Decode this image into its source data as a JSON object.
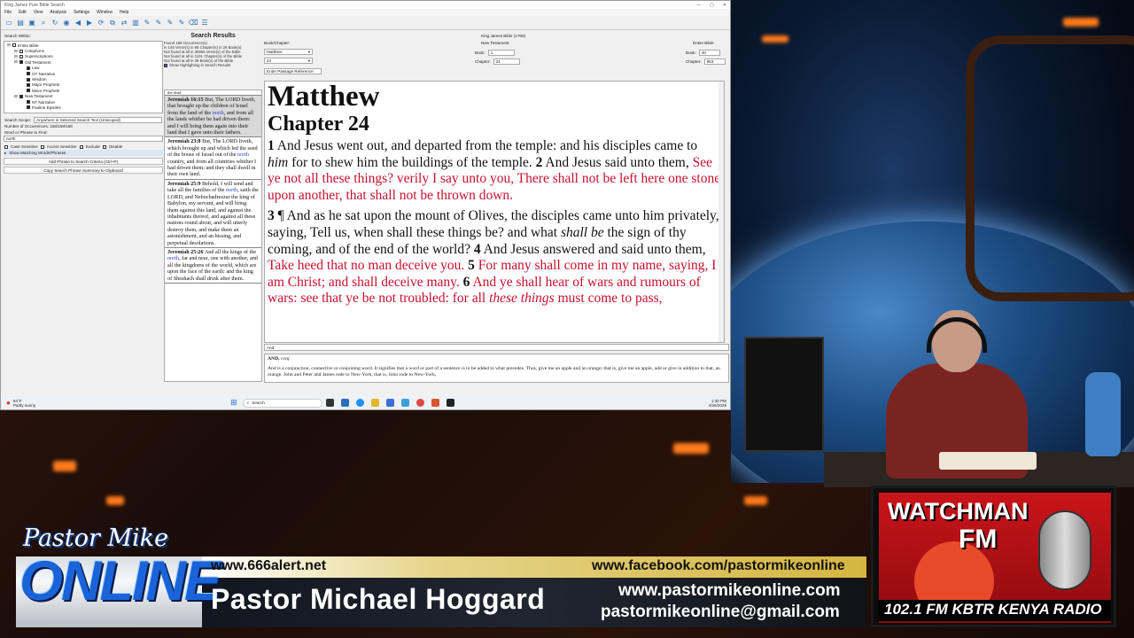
{
  "app": {
    "title": "King James Pure Bible Search",
    "menu": [
      "File",
      "Edit",
      "View",
      "Analysis",
      "Settings",
      "Window",
      "Help"
    ],
    "search_within_label": "Search Within:",
    "tree": [
      {
        "label": "Entire Bible",
        "checked": false,
        "indent": 0
      },
      {
        "label": "Colophons",
        "checked": false,
        "indent": 1
      },
      {
        "label": "Superscriptions",
        "checked": false,
        "indent": 1
      },
      {
        "label": "Old Testament",
        "checked": true,
        "indent": 1
      },
      {
        "label": "Law",
        "checked": true,
        "indent": 2
      },
      {
        "label": "OT Narrative",
        "checked": true,
        "indent": 2
      },
      {
        "label": "Wisdom",
        "checked": true,
        "indent": 2
      },
      {
        "label": "Major Prophets",
        "checked": true,
        "indent": 2
      },
      {
        "label": "Minor Prophets",
        "checked": true,
        "indent": 2
      },
      {
        "label": "New Testament",
        "checked": true,
        "indent": 1
      },
      {
        "label": "NT Narrative",
        "checked": true,
        "indent": 2
      },
      {
        "label": "Pauline Epistles",
        "checked": true,
        "indent": 2
      }
    ],
    "search_scope_label": "Search Scope:",
    "search_scope_value": "Anywhere in Selected Search Text (Unscoped)",
    "occurrences_label": "Number of Occurrences: 158/158/158",
    "word_phrase_label": "Word or Phrase to Find:",
    "search_value": "north",
    "options": [
      "Case Sensitive",
      "Accent Sensitive",
      "Exclude",
      "Disable"
    ],
    "show_matching": "Show Matching Words/Phrases",
    "add_phrase_btn": "Add Phrase to Search Criteria (Ctrl+P)",
    "copy_summary_btn": "Copy Search Phrase Summary to Clipboard",
    "results_header": "Search Results",
    "results_stats": [
      "Found 158 Occurrence(s)",
      "in 146 Verse(s) in 88 Chapter(s) in 28 Book(s)",
      "Not found at all in 30956 Verse(s) of the Bible",
      "Not found at all in 1101 Chapter(s) of the Bible",
      "Not found at all in 38 Book(s) of the Bible",
      "Show Highlighting in Search Results"
    ],
    "results_cut": "the dead.",
    "results": [
      {
        "ref": "Jeremiah 16:15",
        "pre": "But, The LORD liveth, that brought up the children of Israel from the land of the ",
        "hl": "north",
        "post": ", and from all the lands whither he had driven them: and I will bring them again into their land that I gave unto their fathers.",
        "selected": true
      },
      {
        "ref": "Jeremiah 23:8",
        "pre": "But, The LORD liveth, which brought up and which led the seed of the house of Israel out of the ",
        "hl": "north",
        "post": " country, and from all countries whither I had driven them; and they shall dwell in their own land.",
        "selected": false
      },
      {
        "ref": "Jeremiah 25:9",
        "pre": "Behold, I will send and take all the families of the ",
        "hl": "north",
        "post": ", saith the LORD, and Nebuchadrezzar the king of Babylon, my servant, and will bring them against this land, and against the inhabitants thereof, and against all these nations round about, and will utterly destroy them, and make them an astonishment, and an hissing, and perpetual desolations.",
        "selected": false
      },
      {
        "ref": "Jeremiah 25:26",
        "pre": "And all the kings of the ",
        "hl": "north",
        "post": ", far and near, one with another, and all the kingdoms of the world, which are upon the face of the earth: and the king of Sheshach shall drink after them.",
        "selected": false
      }
    ],
    "nav": {
      "book_chapter_label": "Book/Chapter:",
      "book_value": "Matthew",
      "chapter_value": "24",
      "version": "King James Bible (1769)",
      "nt_label": "New Testament",
      "book_label": "Book:",
      "book_num": "1",
      "chapter_label": "Chapter:",
      "chapter_num": "24",
      "entire_label": "Entire Bible:",
      "entire_book": "40",
      "entire_chapter": "953",
      "passage_ref_label": "Enter Passage Reference:"
    },
    "passage": {
      "book": "Matthew",
      "chapter": "Chapter 24",
      "v1_num": "1",
      "v1_a": " And Jesus went out, and departed from the temple: and his disciples came to ",
      "v1_i": "him",
      "v1_b": " for to shew him the buildings of the temple. ",
      "v2_num": "2",
      "v2_a": " And Jesus said unto them, ",
      "v2_red": "See ye not all these things? verily I say unto you, There shall not be left here one stone upon another, that shall not be thrown down.",
      "v3_num": "3",
      "v3_a": " ¶ And as he sat upon the mount of Olives, the disciples came unto him privately, saying, Tell us, when shall these things be? and what ",
      "v3_i": "shall be",
      "v3_b": " the sign of thy coming, and of the end of the world? ",
      "v4_num": "4",
      "v4_a": " And Jesus answered and said unto them, ",
      "v4_red": "Take heed that no man deceive you. ",
      "v5_num": "5",
      "v5_red": " For many shall come in my name, saying, I am Christ; and shall deceive many. ",
      "v6_num": "6",
      "v6_red_a": " And ye shall hear of wars and rumours of wars: see that ye be not troubled: for all ",
      "v6_i": "these things",
      "v6_red_b": " must come to pass,"
    },
    "dict_word": "And",
    "dict_head": "AND,",
    "dict_pos": "conj.",
    "dict_text": "And is a conjunction, connective or conjoining word. It signifies that a word or part of a sentence is to be added to what precedes. Thus, give me an apple and an orange; that is, give me an apple, add or give in addition to that, an orange. John and Peter and James rode to New-York, that is, John rode to New-York,",
    "taskbar": {
      "weather_temp": "64°F",
      "weather_desc": "Partly sunny",
      "search": "Search",
      "time": "1:30 PM",
      "date": "4/26/2025"
    }
  },
  "banner": {
    "logo_script": "Pastor Mike",
    "logo_main": "ONLINE",
    "site1": "www.666alert.net",
    "facebook": "www.facebook.com/pastormikeonline",
    "name": "Pastor Michael Hoggard",
    "site2": "www.pastormikeonline.com",
    "email": "pastormikeonline@gmail.com"
  },
  "radio": {
    "title": "WATCHMAN",
    "fm": "FM",
    "freq": "102.1 FM  KBTR KENYA  RADIO"
  }
}
